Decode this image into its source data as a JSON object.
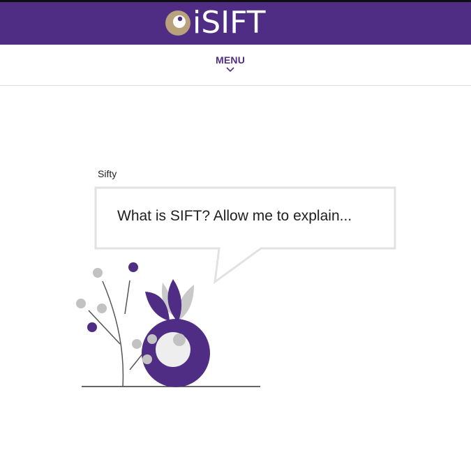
{
  "header": {
    "logo_text": "iSIFT",
    "logo_icon": "eye-icon"
  },
  "nav": {
    "menu_label": "MENU",
    "menu_icon": "chevron-down-icon"
  },
  "chat": {
    "speaker": "Sifty",
    "message": "What is SIFT? Allow me to explain..."
  },
  "colors": {
    "brand_purple": "#4f2d84",
    "logo_gold": "#b9a27b",
    "bubble_border": "#e2e2e2",
    "dot_grey": "#bdbdbd"
  }
}
